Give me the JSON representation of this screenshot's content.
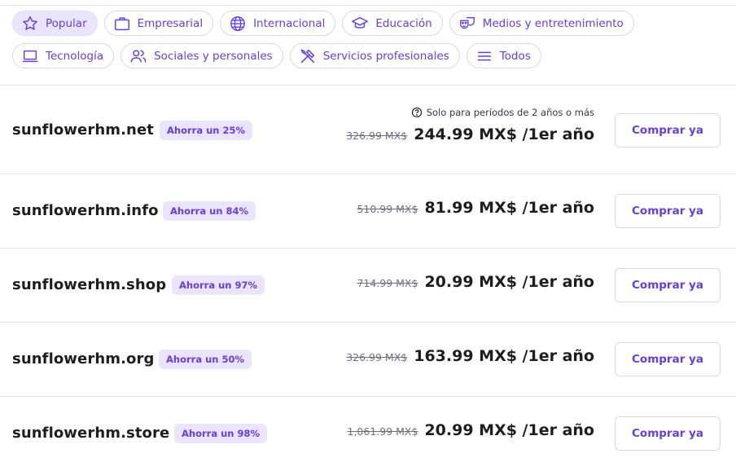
{
  "filters": {
    "row1": [
      {
        "label": "Popular",
        "icon": "star-icon",
        "active": true
      },
      {
        "label": "Empresarial",
        "icon": "briefcase-icon"
      },
      {
        "label": "Internacional",
        "icon": "globe-icon"
      },
      {
        "label": "Educación",
        "icon": "graduation-cap-icon"
      },
      {
        "label": "Medios y entretenimiento",
        "icon": "masks-icon"
      }
    ],
    "row2": [
      {
        "label": "Tecnología",
        "icon": "laptop-icon"
      },
      {
        "label": "Sociales y personales",
        "icon": "people-icon"
      },
      {
        "label": "Servicios profesionales",
        "icon": "tools-icon"
      },
      {
        "label": "Todos",
        "icon": "menu-icon"
      }
    ]
  },
  "note": "Solo para períodos de 2 años o más",
  "domains": [
    {
      "name": "sunflowerhm.net",
      "badge": "Ahorra un 25%",
      "old_price": "326.99 MX$",
      "new_price": "244.99 MX$ /1er año",
      "button": "Comprar ya"
    },
    {
      "name": "sunflowerhm.info",
      "badge": "Ahorra un 84%",
      "old_price": "510.99 MX$",
      "new_price": "81.99 MX$ /1er año",
      "button": "Comprar ya"
    },
    {
      "name": "sunflowerhm.shop",
      "badge": "Ahorra un 97%",
      "old_price": "714.99 MX$",
      "new_price": "20.99 MX$ /1er año",
      "button": "Comprar ya"
    },
    {
      "name": "sunflowerhm.org",
      "badge": "Ahorra un 50%",
      "old_price": "326.99 MX$",
      "new_price": "163.99 MX$ /1er año",
      "button": "Comprar ya"
    },
    {
      "name": "sunflowerhm.store",
      "badge": "Ahorra un 98%",
      "old_price": "1,061.99 MX$",
      "new_price": "20.99 MX$ /1er año",
      "button": "Comprar ya"
    }
  ],
  "colors": {
    "accent": "#673de6",
    "badge_bg": "#ebe4ff",
    "text": "#1d1e20"
  }
}
